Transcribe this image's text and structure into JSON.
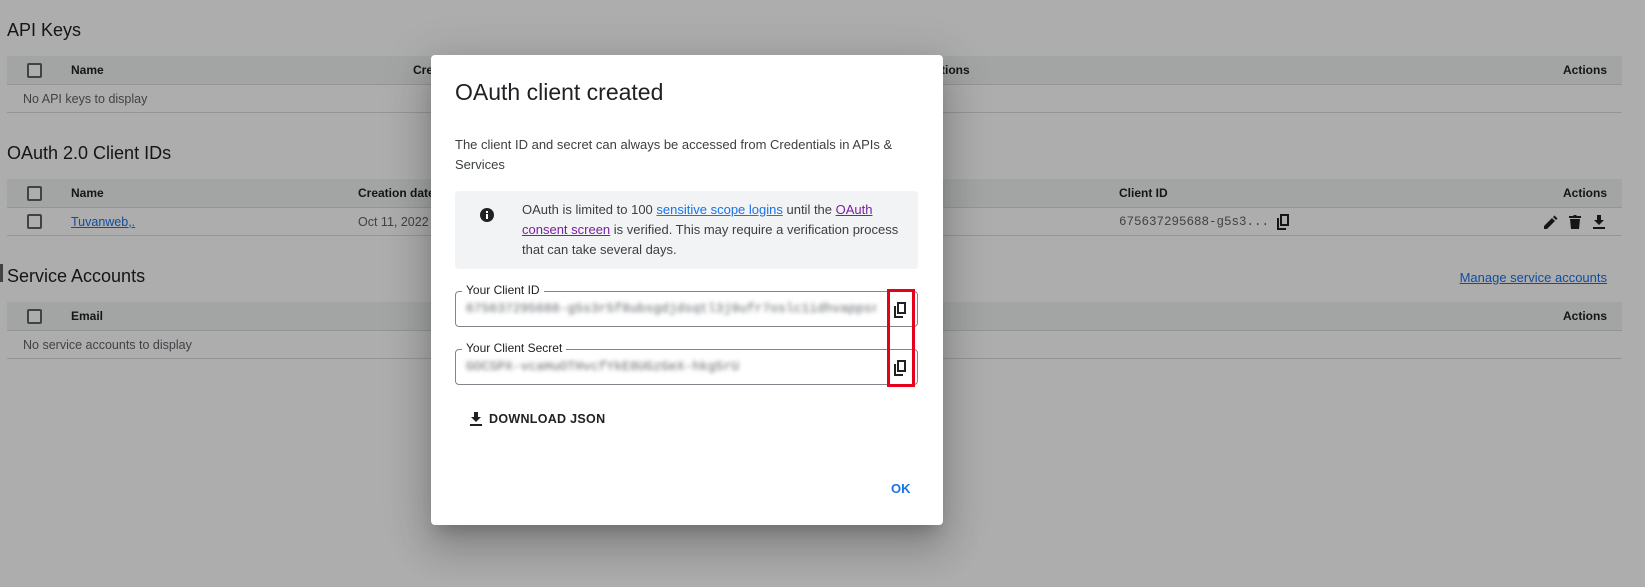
{
  "api_keys": {
    "title": "API Keys",
    "headers": [
      "Name",
      "Cre",
      "tions",
      "Actions"
    ],
    "empty": "No API keys to display"
  },
  "oauth": {
    "title": "OAuth 2.0 Client IDs",
    "headers": [
      "Name",
      "Creation date",
      "Client ID",
      "Actions"
    ],
    "row": {
      "name": "Tuvanweb,.",
      "date": "Oct 11, 2022",
      "client_id": "675637295688-g5s3..."
    }
  },
  "service_accounts": {
    "title": "Service Accounts",
    "manage_link": "Manage service accounts",
    "headers": [
      "Email",
      "Actions"
    ],
    "empty": "No service accounts to display"
  },
  "dialog": {
    "title": "OAuth client created",
    "description": "The client ID and secret can always be accessed from Credentials in APIs & Services",
    "info": {
      "pre": "OAuth is limited to 100 ",
      "link1": "sensitive scope logins",
      "mid": " until the ",
      "link2": "OAuth consent screen",
      "post": " is verified. This may require a verification process that can take several days."
    },
    "client_id_label": "Your Client ID",
    "client_id_value": "675637295688-g5s3r5f8ubsgdjdsqtl3j9ufr7oslc1idhvappsrg",
    "client_secret_label": "Your Client Secret",
    "client_secret_value": "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",
    "download_label": "DOWNLOAD JSON",
    "ok_label": "OK"
  },
  "colors": {
    "accent": "#1a73e8",
    "highlight": "#e6001a",
    "visited_link": "#7b1fa2"
  }
}
